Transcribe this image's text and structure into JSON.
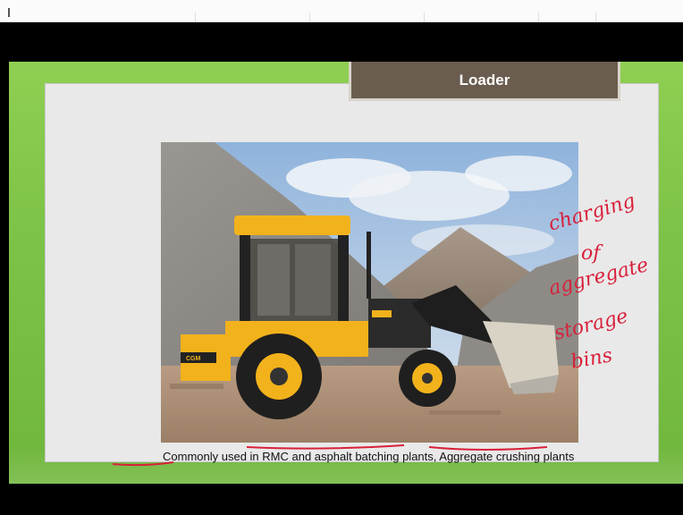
{
  "slide": {
    "title": "Loader",
    "caption": "Commonly used in RMC and asphalt batching plants, Aggregate crushing plants",
    "photo_badge": "CGM",
    "annotation_lines": [
      "charging",
      "of",
      "aggregate",
      "storage",
      "bins"
    ]
  },
  "colors": {
    "slide_green": "#7dc347",
    "title_bar": "#6a5d4f",
    "annotation_ink": "#d8203a",
    "loader_yellow": "#f2b21c"
  }
}
